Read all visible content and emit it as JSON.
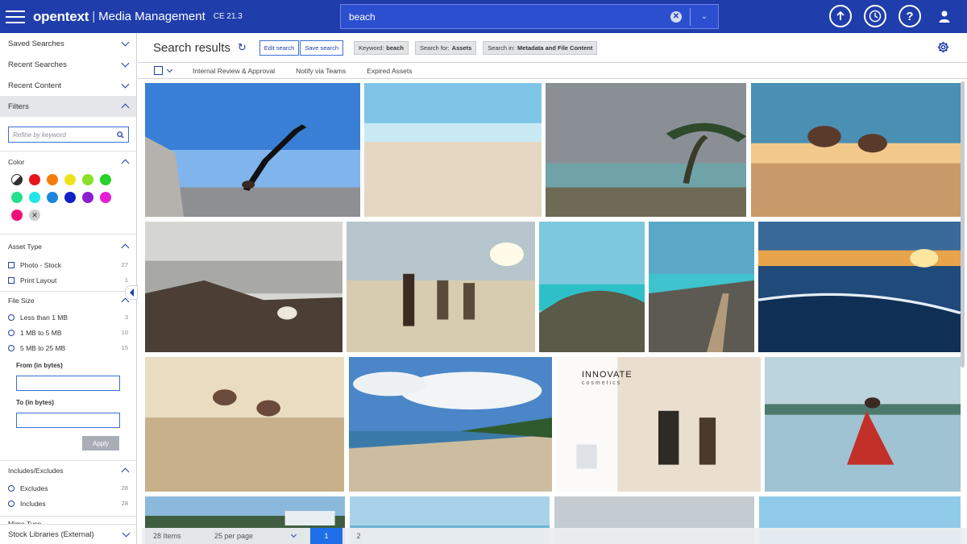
{
  "topbar": {
    "brand": "opentext",
    "app_name": "Media Management",
    "version": "CE 21.3",
    "search_value": "beach",
    "clear_glyph": "✕",
    "dropdown_glyph": "⌄",
    "icons": [
      "upload-icon",
      "history-icon",
      "help-icon",
      "user-icon"
    ],
    "help_glyph": "?"
  },
  "sidebar": {
    "sections": [
      {
        "label": "Saved Searches"
      },
      {
        "label": "Recent Searches"
      },
      {
        "label": "Recent Content"
      },
      {
        "label": "Filters"
      }
    ],
    "refine_placeholder": "Refine by keyword",
    "color": {
      "label": "Color",
      "swatches": [
        "#2f2f2f",
        "#e8141c",
        "#f57c0a",
        "#f0e21a",
        "#8be02a",
        "#28d12b",
        "#22e08c",
        "#1ee7e7",
        "#1a86e0",
        "#1020c8",
        "#8a1fd1",
        "#e61fd6",
        "#f0107a",
        "#cfcfcf"
      ]
    },
    "asset_type": {
      "label": "Asset Type",
      "options": [
        {
          "label": "Photo - Stock",
          "count": "27"
        },
        {
          "label": "Print Layout",
          "count": "1"
        }
      ]
    },
    "file_size": {
      "label": "File Size",
      "options": [
        {
          "label": "Less than 1 MB",
          "count": "3"
        },
        {
          "label": "1 MB to 5 MB",
          "count": "10"
        },
        {
          "label": "5 MB to 25 MB",
          "count": "15"
        }
      ],
      "from_label": "From (in bytes)",
      "to_label": "To (in bytes)",
      "apply_label": "Apply"
    },
    "includes": {
      "label": "Includes/Excludes",
      "options": [
        {
          "label": "Excludes",
          "count": "28"
        },
        {
          "label": "Includes",
          "count": "28"
        }
      ]
    },
    "partial_label": "Mime Type",
    "bottom_label": "Stock Libraries (External)"
  },
  "main": {
    "title": "Search results",
    "edit_search": "Edit search",
    "save_search": "Save search",
    "chips": [
      {
        "key": "Keyword:",
        "value": "beach"
      },
      {
        "key": "Search for:",
        "value": "Assets"
      },
      {
        "key": "Search in:",
        "value": "Metadata and File Content"
      }
    ],
    "actions": [
      "Internal Review & Approval",
      "Notify via Teams",
      "Expired Assets"
    ]
  },
  "results": [
    {
      "caption": "yoga on rocks",
      "scene": "yoga"
    },
    {
      "caption": "sandy beach",
      "scene": "sand"
    },
    {
      "caption": "stormy palm coast",
      "scene": "storm"
    },
    {
      "caption": "friends piggyback at sunset",
      "scene": "sunsetfriends"
    },
    {
      "caption": "woman on rocky shore",
      "scene": "rocks"
    },
    {
      "caption": "friends walking on sand",
      "scene": "group"
    },
    {
      "caption": "turquoise bay",
      "scene": "bay"
    },
    {
      "caption": "coastal boardwalk",
      "scene": "boardwalk"
    },
    {
      "caption": "sunset over waves",
      "scene": "sunsetwaves"
    },
    {
      "caption": "piggyback race on beach",
      "scene": "piggyback"
    },
    {
      "caption": "clouds over shoreline",
      "scene": "clouds"
    },
    {
      "caption": "INNOVATE cosmetics print layout",
      "scene": "print"
    },
    {
      "caption": "woman in red dress over water",
      "scene": "reddress"
    },
    {
      "caption": "coastal town",
      "scene": "town"
    },
    {
      "caption": "calm sea",
      "scene": "calm"
    },
    {
      "caption": "grey sky",
      "scene": "grey"
    },
    {
      "caption": "blue horizon",
      "scene": "blue"
    }
  ],
  "print_layout": {
    "headline": "INNOVATE",
    "subline": "cosmetics"
  },
  "footer": {
    "items": "28 Items",
    "per_page": "25 per page",
    "pages": [
      "1",
      "2"
    ]
  },
  "colors": {
    "brand_blue": "#1f3dab",
    "accent_blue": "#1f6fe8"
  }
}
